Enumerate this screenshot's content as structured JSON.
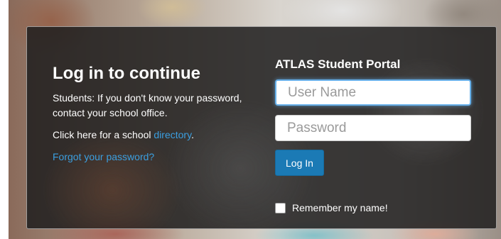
{
  "login": {
    "heading": "Log in to continue",
    "students_note": "Students: If you don't know your password, contact your school office.",
    "directory_prefix": "Click here for a school ",
    "directory_link": "directory",
    "directory_suffix": ".",
    "forgot_link": "Forgot your password?"
  },
  "portal": {
    "title": "ATLAS Student Portal",
    "username_placeholder": "User Name",
    "password_placeholder": "Password",
    "login_button": "Log In",
    "remember_label": "Remember my name!",
    "remember_checked": false
  },
  "colors": {
    "link": "#3b9fe0",
    "button": "#1b7ab5",
    "focus": "#66afe9"
  }
}
